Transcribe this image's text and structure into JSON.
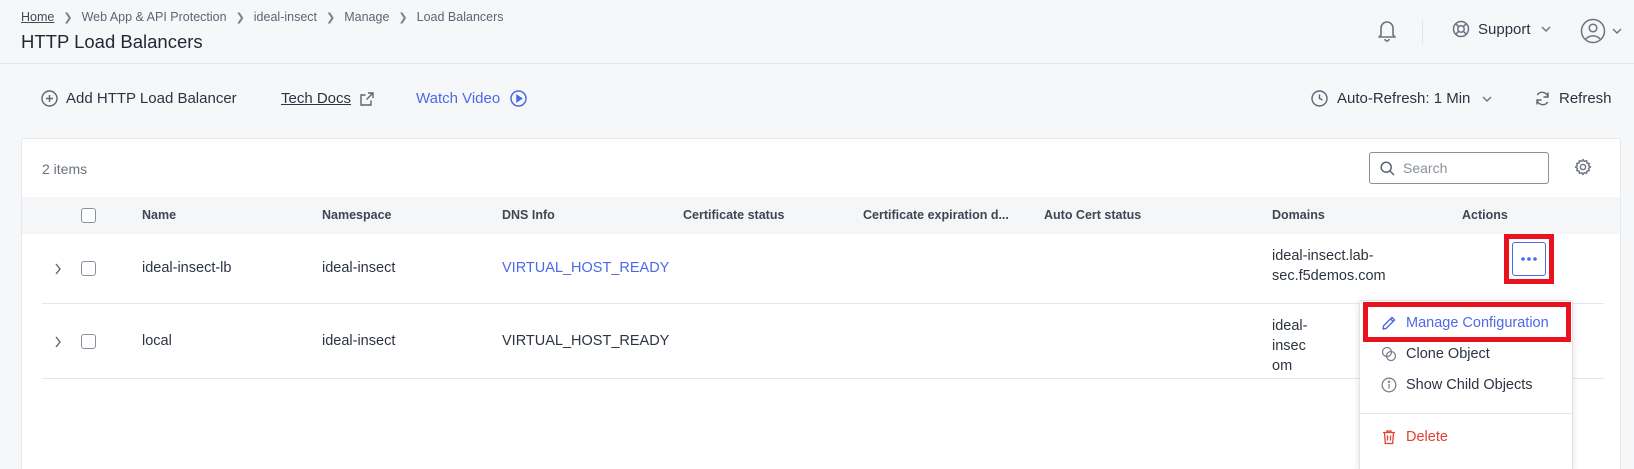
{
  "header": {
    "breadcrumb": [
      "Home",
      "Web App & API Protection",
      "ideal-insect",
      "Manage",
      "Load Balancers"
    ],
    "title": "HTTP Load Balancers",
    "support_label": "Support"
  },
  "toolbar": {
    "add_label": "Add HTTP Load Balancer",
    "tech_docs_label": "Tech Docs",
    "watch_video_label": "Watch Video",
    "auto_refresh_label": "Auto-Refresh: 1 Min",
    "refresh_label": "Refresh"
  },
  "table": {
    "item_count": "2 items",
    "search_placeholder": "Search",
    "columns": [
      "Name",
      "Namespace",
      "DNS Info",
      "Certificate status",
      "Certificate expiration d...",
      "Auto Cert status",
      "Domains",
      "Actions"
    ],
    "rows": [
      {
        "name": "ideal-insect-lb",
        "namespace": "ideal-insect",
        "dns_info": "VIRTUAL_HOST_READY",
        "domains_line1": "ideal-insect.lab-",
        "domains_line2": "sec.f5demos.com",
        "domains_line3": ""
      },
      {
        "name": "local",
        "namespace": "ideal-insect",
        "dns_info": "VIRTUAL_HOST_READY",
        "domains_line1": "ideal-",
        "domains_line2": "insec",
        "domains_line3": "om"
      }
    ]
  },
  "menu": {
    "manage": "Manage Configuration",
    "clone": "Clone Object",
    "child": "Show Child Objects",
    "delete": "Delete"
  },
  "colors": {
    "accent": "#4e68e8",
    "highlight": "#e8131f",
    "danger": "#e0402f"
  }
}
